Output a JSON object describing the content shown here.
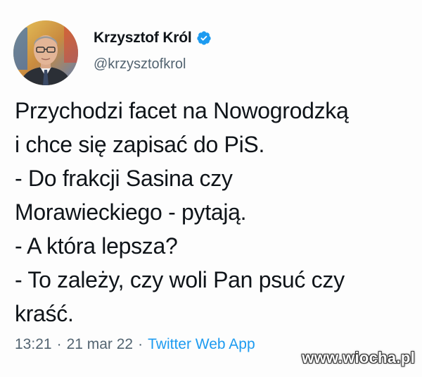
{
  "author": {
    "display_name": "Krzysztof Król",
    "handle": "@krzysztofkrol",
    "verified_icon": "verified-badge-icon",
    "verified_color": "#1d9bf0"
  },
  "tweet": {
    "lines": [
      "Przychodzi facet na Nowogrodzką",
      "i chce się zapisać do PiS.",
      "- Do frakcji Sasina czy",
      "Morawieckiego - pytają.",
      "- A która lepsza?",
      "- To zależy, czy woli Pan psuć czy",
      "kraść."
    ]
  },
  "meta": {
    "time": "13:21",
    "separator": "·",
    "date": "21 mar 22",
    "source": "Twitter Web App"
  },
  "watermark": {
    "text": "www.wiocha.pl"
  },
  "colors": {
    "text_primary": "#0f1419",
    "text_secondary": "#536471",
    "link": "#1d9bf0"
  }
}
